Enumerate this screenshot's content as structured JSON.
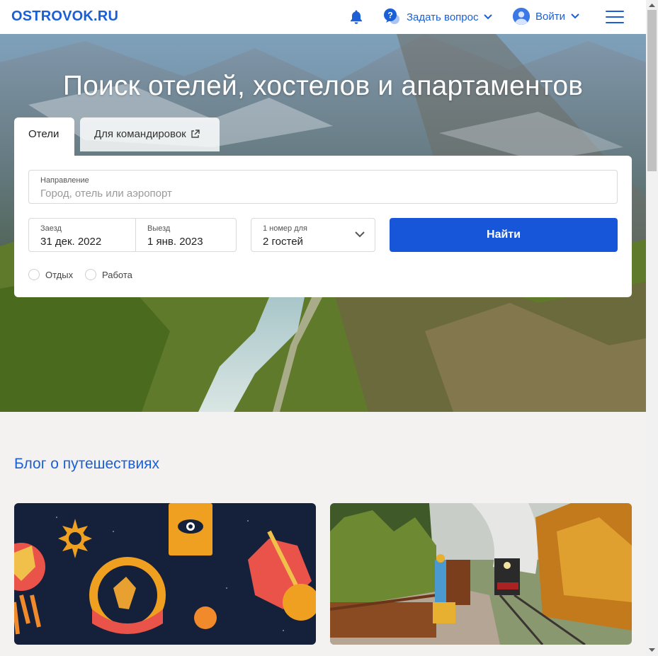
{
  "header": {
    "logo": "OSTROVOK.RU",
    "ask_label": "Задать вопрос",
    "login_label": "Войти"
  },
  "hero": {
    "title": "Поиск отелей, хостелов и апартаментов",
    "tabs": [
      {
        "label": "Отели",
        "active": true
      },
      {
        "label": "Для командировок",
        "active": false
      }
    ]
  },
  "search": {
    "destination": {
      "label": "Направление",
      "placeholder": "Город, отель или аэропорт"
    },
    "checkin": {
      "label": "Заезд",
      "value": "31 дек. 2022"
    },
    "checkout": {
      "label": "Выезд",
      "value": "1 янв. 2023"
    },
    "guests": {
      "label": "1 номер для",
      "value": "2 гостей"
    },
    "button_label": "Найти",
    "purpose": [
      {
        "label": "Отдых",
        "checked": false
      },
      {
        "label": "Работа",
        "checked": false
      }
    ]
  },
  "blog": {
    "title": "Блог о путешествиях"
  },
  "colors": {
    "brand": "#1b5fd6",
    "button": "#1756d8",
    "page_bg": "#f3f2f1"
  }
}
